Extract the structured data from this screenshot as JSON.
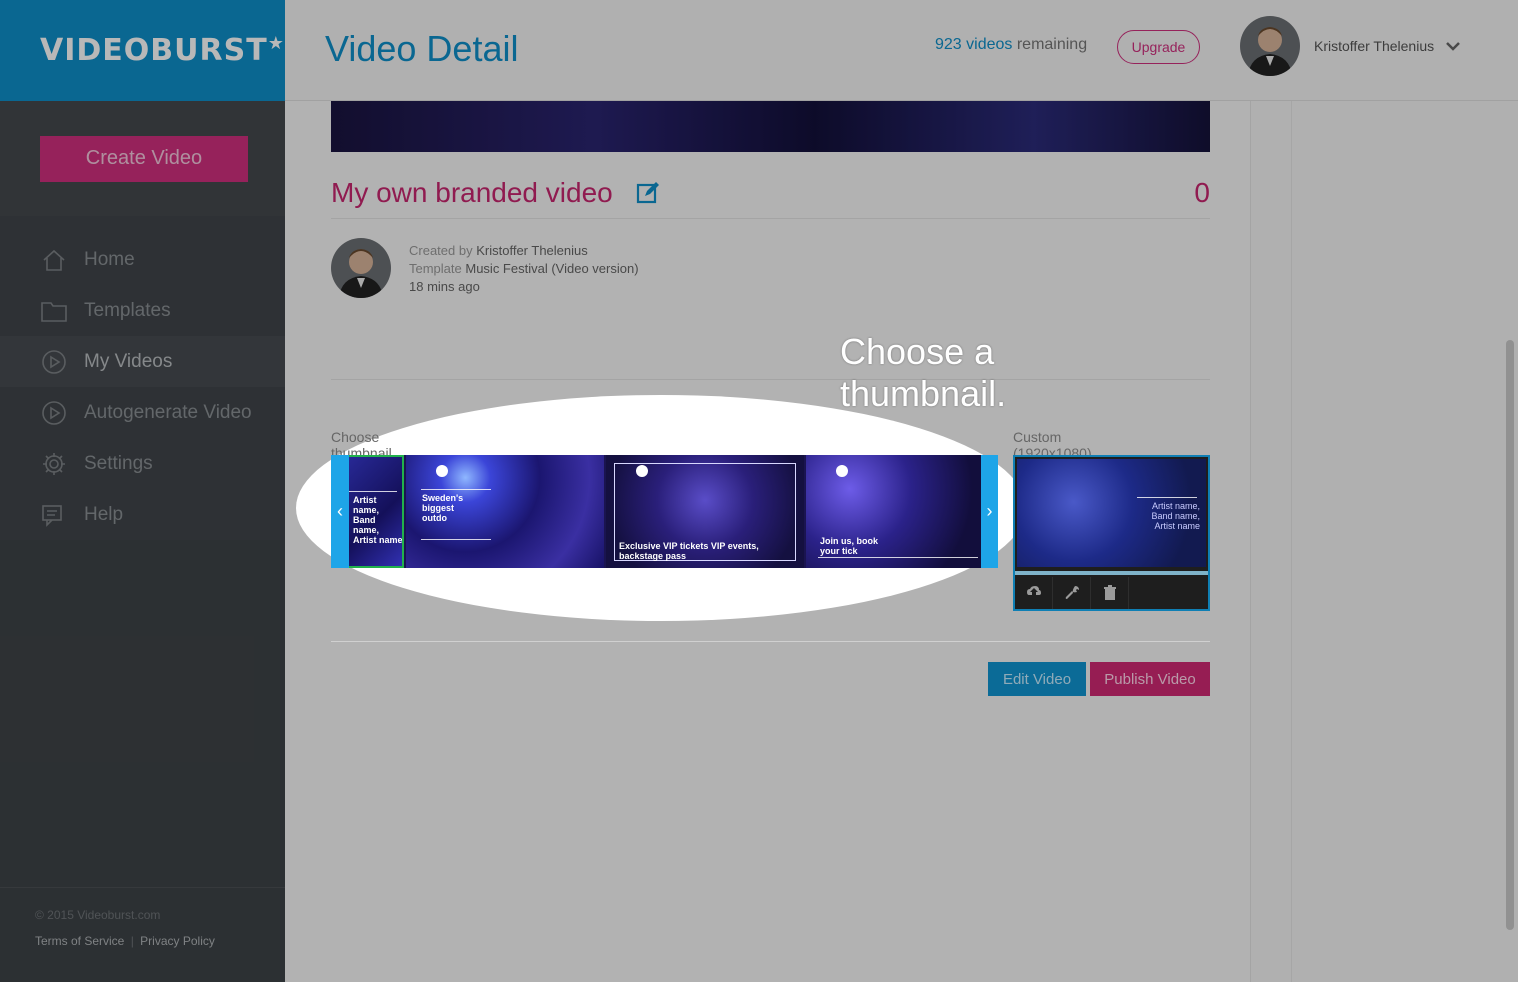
{
  "brand": {
    "logo_text": "VIDEOBURST",
    "logo_star": "★"
  },
  "sidebar": {
    "create_label": "Create Video",
    "items": [
      {
        "label": "Home",
        "icon": "home-icon"
      },
      {
        "label": "Templates",
        "icon": "folder-icon"
      },
      {
        "label": "My Videos",
        "icon": "play-circle-icon",
        "active": true
      },
      {
        "label": "Autogenerate Video",
        "icon": "play-circle-icon"
      },
      {
        "label": "Settings",
        "icon": "gear-icon"
      },
      {
        "label": "Help",
        "icon": "help-icon"
      }
    ],
    "footer": {
      "copyright": "© 2015 Videoburst.com",
      "terms": "Terms of Service",
      "separator": "|",
      "privacy": "Privacy Policy"
    }
  },
  "header": {
    "title": "Video Detail",
    "remaining_count": "923 videos",
    "remaining_suffix": " remaining",
    "upgrade_label": "Upgrade",
    "user_name": "Kristoffer Thelenius"
  },
  "video": {
    "title": "My own branded video",
    "views": "0",
    "created_by_label": "Created by",
    "created_by": "Kristoffer Thelenius",
    "template_label": "Template",
    "template": "Music Festival (Video version)",
    "age": "18 mins ago"
  },
  "tutorial": {
    "hint": "Choose a thumbnail."
  },
  "thumbnails": {
    "label": "Choose thumbnail",
    "custom_label": "Custom (1920x1080)",
    "frames": [
      {
        "text": "Artist name, Band name, Artist name"
      },
      {
        "text": "Sweden's biggest outdo"
      },
      {
        "text": "Exclusive VIP tickets VIP events, backstage pass"
      },
      {
        "text": "Join us, book your tick"
      }
    ],
    "custom_text": "Artist name, Band name, Artist name"
  },
  "actions": {
    "edit_label": "Edit Video",
    "publish_label": "Publish Video"
  },
  "colors": {
    "brand_blue": "#0f8fc9",
    "brand_pink": "#c8266f",
    "sidebar_bg": "#3e4347"
  }
}
